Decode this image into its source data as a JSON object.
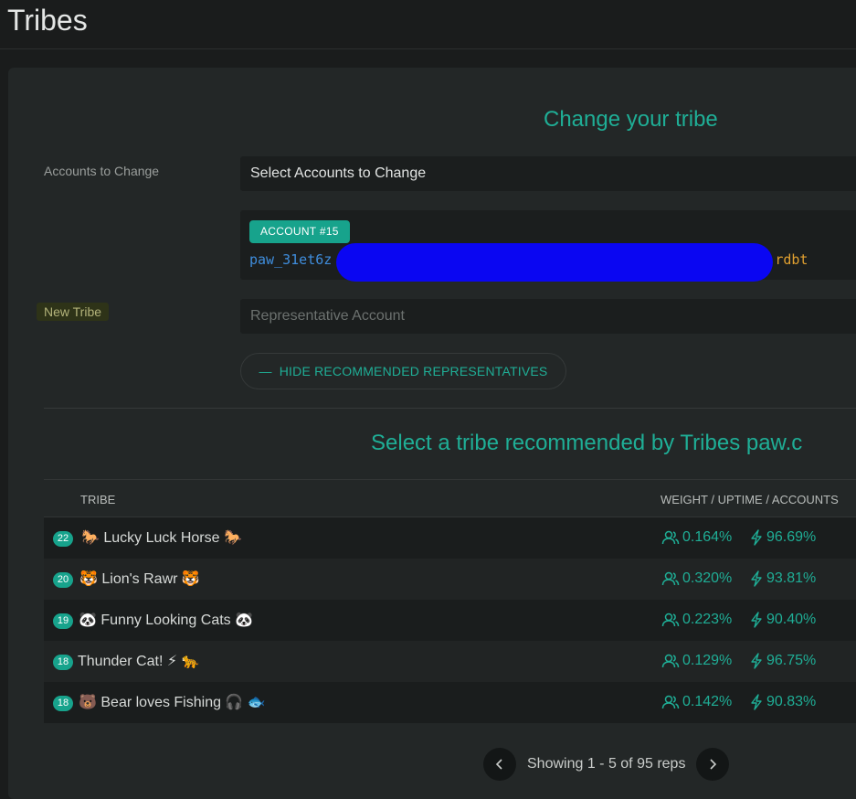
{
  "page": {
    "title": "Tribes"
  },
  "change_section": {
    "title": "Change your tribe",
    "accounts_label": "Accounts to Change",
    "accounts_select": "Select Accounts to Change",
    "account_badge": "ACCOUNT #15",
    "address_start": "paw_31et6z",
    "address_end": "rdbt",
    "new_tribe_label": "New Tribe",
    "rep_placeholder": "Representative Account",
    "hide_button": "HIDE RECOMMENDED REPRESENTATIVES"
  },
  "recommended": {
    "title": "Select a tribe recommended by Tribes paw.c",
    "columns": {
      "tribe": "TRIBE",
      "stats": "WEIGHT / UPTIME / ACCOUNTS"
    },
    "rows": [
      {
        "rank": "22",
        "name": "🐎 Lucky Luck Horse 🐎",
        "weight": "0.164%",
        "uptime": "96.69%"
      },
      {
        "rank": "20",
        "name": "🐯 Lion's Rawr 🐯",
        "weight": "0.320%",
        "uptime": "93.81%"
      },
      {
        "rank": "19",
        "name": "🐼 Funny Looking Cats 🐼",
        "weight": "0.223%",
        "uptime": "90.40%"
      },
      {
        "rank": "18",
        "name": "Thunder Cat! ⚡ 🐆",
        "weight": "0.129%",
        "uptime": "96.75%"
      },
      {
        "rank": "18",
        "name": "🐻 Bear loves Fishing 🎧 🐟",
        "weight": "0.142%",
        "uptime": "90.83%"
      }
    ]
  },
  "pagination": {
    "text": "Showing 1 - 5 of 95 reps"
  },
  "colors": {
    "accent": "#1fae96",
    "badge": "#17a38c",
    "redaction": "#0a06f2"
  }
}
